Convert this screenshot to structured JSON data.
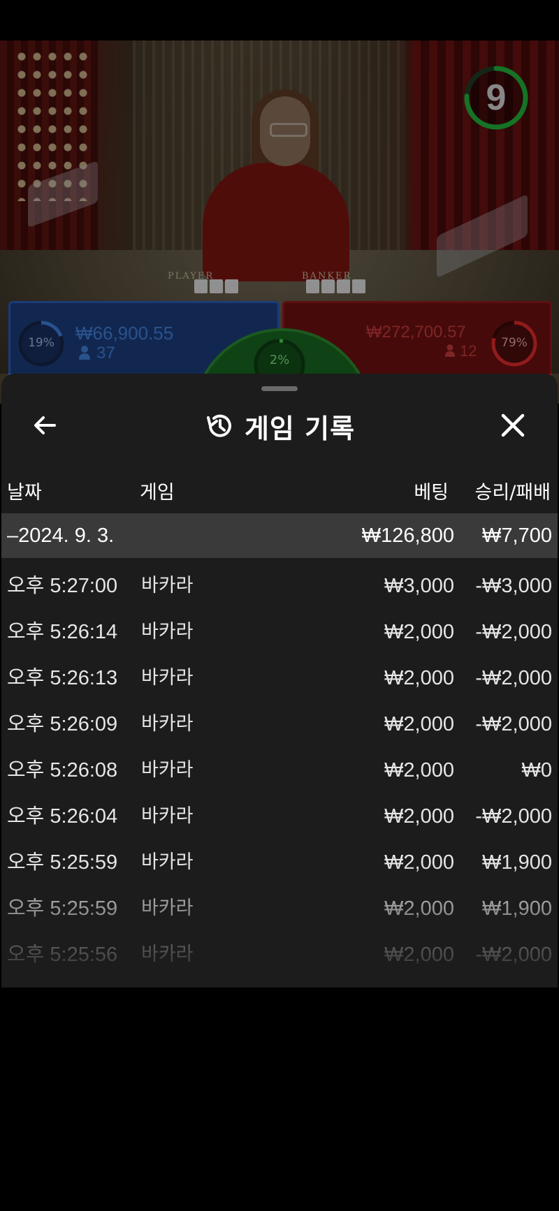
{
  "game_view": {
    "countdown": "9",
    "player_label": "PLAYER",
    "banker_label": "BANKER",
    "player_bet": {
      "percent": "19%",
      "amount": "₩66,900.55",
      "players": "37"
    },
    "banker_bet": {
      "percent": "79%",
      "amount": "₩272,700.57",
      "players": "12"
    },
    "tie_bet": {
      "percent": "2%"
    }
  },
  "history": {
    "title": "게임 기록",
    "icons": {
      "back": "arrow-left-icon",
      "history": "history-clock-icon",
      "close": "close-icon"
    },
    "columns": {
      "date": "날짜",
      "game": "게임",
      "bet": "베팅",
      "win_loss": "승리/패배"
    },
    "summary": {
      "date": "–2024. 9. 3.",
      "bet": "₩126,800",
      "win_loss": "₩7,700"
    },
    "rows": [
      {
        "time": "오후 5:27:00",
        "game": "바카라",
        "bet": "₩3,000",
        "win_loss": "-₩3,000"
      },
      {
        "time": "오후 5:26:14",
        "game": "바카라",
        "bet": "₩2,000",
        "win_loss": "-₩2,000"
      },
      {
        "time": "오후 5:26:13",
        "game": "바카라",
        "bet": "₩2,000",
        "win_loss": "-₩2,000"
      },
      {
        "time": "오후 5:26:09",
        "game": "바카라",
        "bet": "₩2,000",
        "win_loss": "-₩2,000"
      },
      {
        "time": "오후 5:26:08",
        "game": "바카라",
        "bet": "₩2,000",
        "win_loss": "₩0"
      },
      {
        "time": "오후 5:26:04",
        "game": "바카라",
        "bet": "₩2,000",
        "win_loss": "-₩2,000"
      },
      {
        "time": "오후 5:25:59",
        "game": "바카라",
        "bet": "₩2,000",
        "win_loss": "₩1,900"
      },
      {
        "time": "오후 5:25:59",
        "game": "바카라",
        "bet": "₩2,000",
        "win_loss": "₩1,900"
      },
      {
        "time": "오후 5:25:56",
        "game": "바카라",
        "bet": "₩2,000",
        "win_loss": "-₩2,000"
      }
    ]
  }
}
